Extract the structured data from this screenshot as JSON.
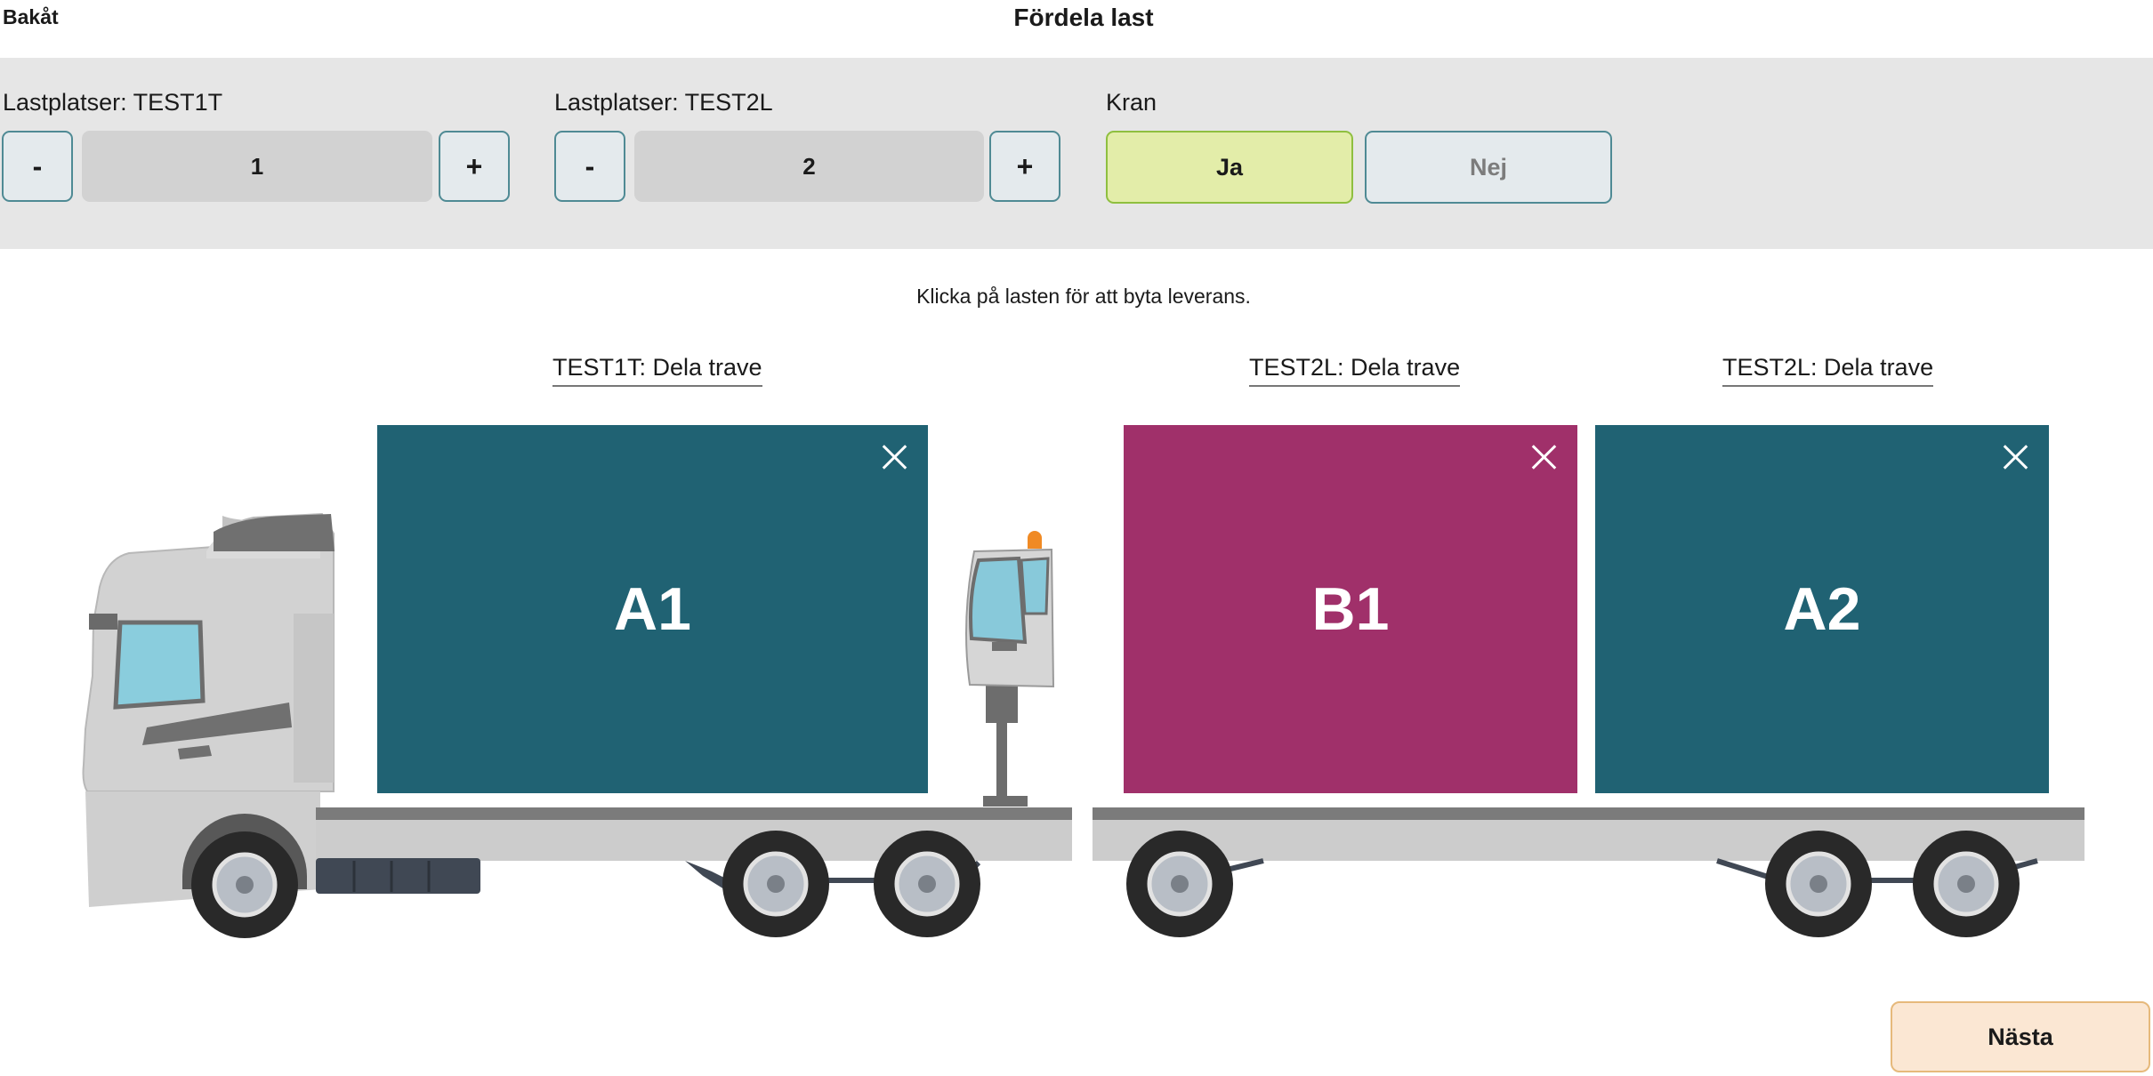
{
  "header": {
    "back_label": "Bakåt",
    "title": "Fördela last"
  },
  "controls": {
    "location1": {
      "label": "Lastplatser: TEST1T",
      "minus": "-",
      "value": "1",
      "plus": "+"
    },
    "location2": {
      "label": "Lastplatser: TEST2L",
      "minus": "-",
      "value": "2",
      "plus": "+"
    },
    "crane": {
      "label": "Kran",
      "yes": "Ja",
      "no": "Nej",
      "selected": "Ja"
    }
  },
  "hint": "Klicka på lasten för att byta leverans.",
  "split_links": [
    "TEST1T: Dela trave",
    "TEST2L: Dela trave",
    "TEST2L: Dela trave"
  ],
  "cargo": [
    {
      "label": "A1",
      "color": "#206273"
    },
    {
      "label": "B1",
      "color": "#a0306a"
    },
    {
      "label": "A2",
      "color": "#206273"
    }
  ],
  "footer": {
    "next_label": "Nästa"
  },
  "colors": {
    "accent_border": "#4f8a94",
    "selected_green": "#e3eda9",
    "next_orange": "#fbe7d3"
  }
}
